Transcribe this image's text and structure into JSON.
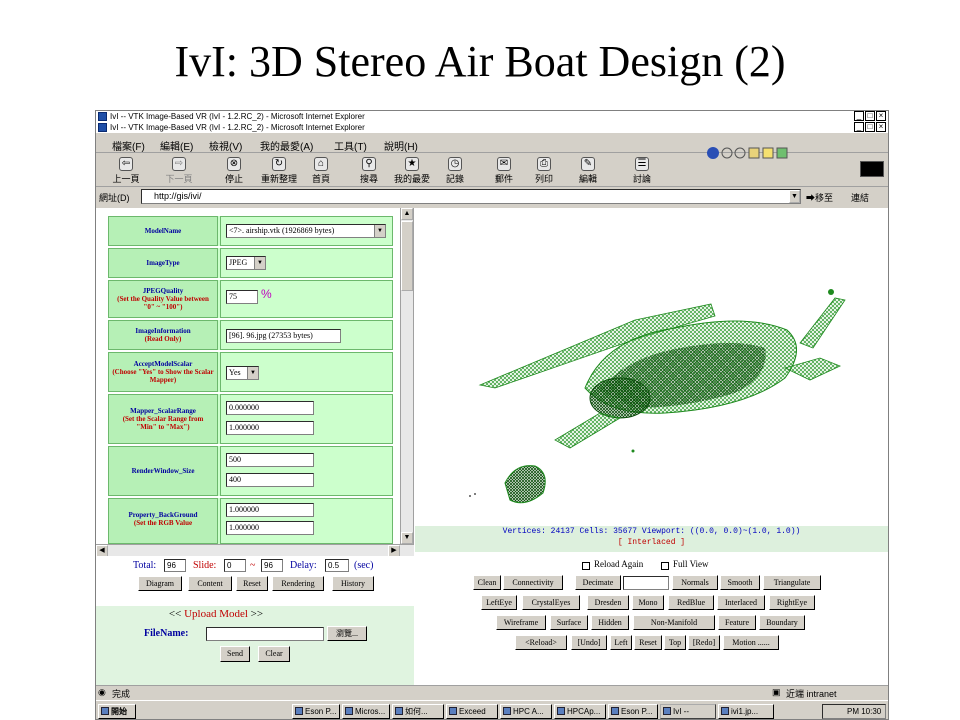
{
  "slide": {
    "title": "IvI: 3D Stereo Air Boat Design (2)"
  },
  "windows": {
    "title1": "IvI -- VTK Image-Based VR (IvI - 1.2.RC_2) - Microsoft Internet Explorer",
    "title2": "IvI -- VTK Image-Based VR (IvI - 1.2.RC_2) - Microsoft Internet Explorer",
    "min": "_",
    "max": "□",
    "close": "×"
  },
  "menu": [
    {
      "label": "檔案",
      "key": "(F)"
    },
    {
      "label": "編輯",
      "key": "(E)"
    },
    {
      "label": "檢視",
      "key": "(V)"
    },
    {
      "label": "我的最愛",
      "key": "(A)"
    },
    {
      "label": "工具",
      "key": "(T)"
    },
    {
      "label": "說明",
      "key": "(H)"
    }
  ],
  "toolbar": [
    {
      "icon": "back-icon",
      "glyph": "⇦",
      "label": "上一頁"
    },
    {
      "icon": "forward-icon",
      "glyph": "⇨",
      "label": "下一頁"
    },
    {
      "icon": "stop-icon",
      "glyph": "⊗",
      "label": "停止"
    },
    {
      "icon": "refresh-icon",
      "glyph": "↻",
      "label": "重新整理"
    },
    {
      "icon": "home-icon",
      "glyph": "⌂",
      "label": "首頁"
    },
    {
      "icon": "search-icon",
      "glyph": "⚲",
      "label": "搜尋"
    },
    {
      "icon": "favorites-icon",
      "glyph": "★",
      "label": "我的最愛"
    },
    {
      "icon": "history-icon",
      "glyph": "◷",
      "label": "記錄"
    },
    {
      "icon": "mail-icon",
      "glyph": "✉",
      "label": "郵件"
    },
    {
      "icon": "print-icon",
      "glyph": "⎙",
      "label": "列印"
    },
    {
      "icon": "edit-icon",
      "glyph": "✎",
      "label": "編輯"
    },
    {
      "icon": "discuss-icon",
      "glyph": "☰",
      "label": "討論"
    }
  ],
  "address": {
    "label": "網址(D)",
    "url": "http://gis/ivi/",
    "go": "移至",
    "links": "連結"
  },
  "params": [
    {
      "label": "ModelName",
      "note": ""
    },
    {
      "label": "ImageType",
      "note": ""
    },
    {
      "label": "JPEGQuality",
      "note": "(Set the Quality Value between \"0\" ~ \"100\")"
    },
    {
      "label": "ImageInformation",
      "note": "(Read Only)"
    },
    {
      "label": "AcceptModelScalar",
      "note": "(Choose \"Yes\" to Show the Scalar Mapper)"
    },
    {
      "label": "Mapper_ScalarRange",
      "note": "(Set the Scalar Range from \"Min\" to \"Max\")"
    },
    {
      "label": "RenderWindow_Size",
      "note": ""
    },
    {
      "label": "Property_BackGround",
      "note": "(Set the RGB Value"
    }
  ],
  "values": {
    "model_name": "<7>. airship.vtk (1926869 bytes)",
    "image_type": "JPEG",
    "jpeg_quality": "75",
    "percent": "%",
    "image_info": "[96]. 96.jpg (27353 bytes)",
    "accept_scalar": "Yes",
    "scalar_min": "0.000000",
    "scalar_max": "1.000000",
    "win_w": "500",
    "win_h": "400",
    "bg_r": "1.000000",
    "bg_g": "1.000000"
  },
  "render_info": {
    "line1": "Vertices: 24137   Cells: 35677   Viewport: ((0.0, 0.0)~(1.0, 1.0))",
    "line2": "[ Interlaced ]"
  },
  "slide_controls": {
    "total_label": "Total:",
    "total_value": "96",
    "slide_label": "Slide:",
    "slide_from": "0",
    "tilde": "~",
    "slide_to": "96",
    "delay_label": "Delay:",
    "delay_value": "0.5",
    "sec_label": "(sec)"
  },
  "nav_buttons": [
    "Diagram",
    "Content",
    "Reset",
    "Rendering",
    "History"
  ],
  "upload": {
    "left_arrows": "<<",
    "title": "Upload Model",
    "right_arrows": ">>",
    "filename_label": "FileName:",
    "browse": "瀏覽...",
    "send": "Send",
    "clear": "Clear"
  },
  "options": {
    "reload_again": "Reload Again",
    "full_view": "Full View"
  },
  "filters": {
    "row1": [
      "Clean",
      "Connectivity",
      "Decimate",
      "",
      "Normals",
      "Smooth",
      "Triangulate"
    ],
    "row2": [
      "LeftEye",
      "CrystalEyes",
      "Dresden",
      "Mono",
      "RedBlue",
      "Interlaced",
      "RightEye"
    ],
    "row3": [
      "Wireframe",
      "Surface",
      "Hidden",
      "Non-Manifold",
      "Feature",
      "Boundary"
    ],
    "row4": [
      "<Reload>",
      "[Undo]",
      "Left",
      "Reset",
      "Top",
      "[Redo]",
      "Motion ......"
    ]
  },
  "statusbar": {
    "done": "完成",
    "zone": "近端 intranet"
  },
  "taskbar": {
    "start": "開始",
    "tasks": [
      "Eson P...",
      "Micros...",
      "如何...",
      "Exceed",
      "HPC A...",
      "HPCAp...",
      "Eson P...",
      "IvI --",
      "ivi1.jp..."
    ],
    "clock": "PM 10:30"
  },
  "colors": {
    "panel_green": "#ccffcc",
    "label_green": "#b6f0b6",
    "label_blue": "#0000a0",
    "note_red": "#c00000",
    "model_green": "#1e8a1e",
    "window_gray": "#d4d0c8"
  }
}
